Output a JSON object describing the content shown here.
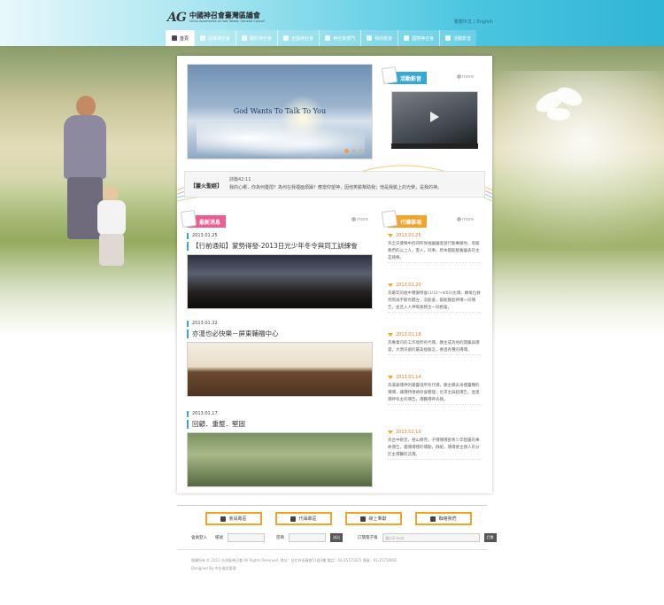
{
  "header": {
    "logo_mark": "AG",
    "logo_cn": "中國神召會臺灣區議會",
    "logo_en": "China Assemblies of God Taiwan General Council",
    "lang": [
      "繁體中文",
      "English"
    ]
  },
  "nav": [
    {
      "label": "首頁",
      "icon": "home-icon",
      "active": true
    },
    {
      "label": "認識神召會",
      "icon": "book-icon"
    },
    {
      "label": "關於神召會",
      "icon": "heart-icon"
    },
    {
      "label": "全國神召會",
      "icon": "map-pin-icon"
    },
    {
      "label": "神召會部門",
      "icon": "people-icon"
    },
    {
      "label": "我的教會",
      "icon": "church-icon"
    },
    {
      "label": "國際神召會",
      "icon": "globe-icon"
    },
    {
      "label": "活動影音",
      "icon": "film-icon"
    }
  ],
  "banner": {
    "text": "God Wants To Talk To You",
    "dots": 3,
    "active_dot": 0
  },
  "video_section": {
    "title": "活動影音",
    "more": "more"
  },
  "verse": {
    "label": "【靈火聖經】",
    "ref": "詩篇42:11",
    "text": "我的心哪，你為何憂悶？為何在我裡面煩躁？應當仰望神，因他笑臉幫助我；他是我臉上的光榮，是我的神。"
  },
  "news": {
    "title": "最新消息",
    "more": "more",
    "items": [
      {
        "date": "2013.01.25",
        "title": "【行前通知】蒙勢得發-2013日光少年冬令與同工訓練會"
      },
      {
        "date": "2013.01.22",
        "title": "亦溫也必快樂－屏東輔福中心"
      },
      {
        "date": "2013.01.17",
        "title": "回顧．重整．堅固"
      }
    ]
  },
  "prayer": {
    "title": "代禱事項",
    "more": "more",
    "items": [
      {
        "date": "2013.01.25",
        "text": "為全日健樂中的四所保福園園進發行動專欄你，尋蹤教們的公上人，客人，同事，原本都能饒養園表的主是禧樂。"
      },
      {
        "date": "2013.01.20",
        "text": "為屬年的給中實懈特會(1/31～4/01)也禱，願每位教完際再不斷有醒左，沒能會，都能獲超神禱一同禱告，並且入人神每服務主一同相會。"
      },
      {
        "date": "2013.01.18",
        "text": "為專業司的工作境所有代禱，願主成為他的開藥與禱當，大領深處的屬美福服怎，要過各種的禱禱。"
      },
      {
        "date": "2013.01.14",
        "text": "為兼兼禱神的屬靈境所有代禱，願主賜去身禮靈種的禱禱，讓禱特禧頭效會體理；也求主與超禱告，並連禱神有主的禱告，禱醬禱神去禧。"
      },
      {
        "date": "2013.01.10",
        "text": "為台中教堂，德山教完，子禱禱禱部青少年配屬的事故禱告，趨禱禱禮的禱勤，群組，禱禱要主親人有分於主禱醫的這禱。"
      }
    ]
  },
  "footer": {
    "buttons": [
      {
        "label": "會員專區",
        "icon": "member-icon"
      },
      {
        "label": "代禱專區",
        "icon": "prayer-icon"
      },
      {
        "label": "線上奉獻",
        "icon": "offering-icon"
      },
      {
        "label": "聯絡我們",
        "icon": "mail-icon"
      }
    ],
    "login_label": "會員登入",
    "account_label": "帳號",
    "password_label": "密碼",
    "go": "送出",
    "subscribe_label": "訂閱電子報",
    "subscribe_placeholder": "輸入E-mail",
    "subscribe_go": "訂閱",
    "copyright": "版權所有 © 2013 台灣區神召會 All Rights Reserved.  地址：台北市長春路51號3樓  電話：02-25715015  傳真：02-25718082",
    "design": "Designed By 中台資訊管理"
  },
  "colors": {
    "accent": "#36a7d8",
    "news": "#ec5e91",
    "prayer": "#f3a327"
  }
}
